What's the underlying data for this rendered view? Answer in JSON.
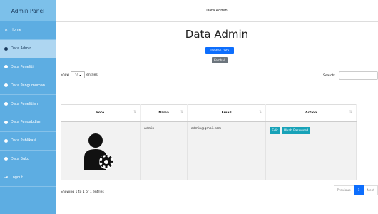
{
  "sidebar": {
    "brand": "Admin Panel",
    "items": [
      {
        "label": "Home",
        "icon": "home-icon"
      },
      {
        "label": "Data Admin",
        "icon": "circle-icon",
        "active": true
      },
      {
        "label": "Data Peneliti",
        "icon": "circle-icon"
      },
      {
        "label": "Data Pengumuman",
        "icon": "circle-icon"
      },
      {
        "label": "Data Penelitian",
        "icon": "circle-icon"
      },
      {
        "label": "Data Pengabdian",
        "icon": "circle-icon"
      },
      {
        "label": "Data Publikasi",
        "icon": "circle-icon"
      },
      {
        "label": "Data Buku",
        "icon": "circle-icon"
      },
      {
        "label": "Logout",
        "icon": "logout-icon"
      }
    ]
  },
  "header": {
    "title": "Data Admin"
  },
  "main": {
    "title": "Data Admin",
    "add_button": "Tambah Data",
    "back_button": "Kembali",
    "show_label": "Show",
    "show_value": "10",
    "entries_label": "entries",
    "search_label": "Search:"
  },
  "table": {
    "columns": [
      "Foto",
      "Nama",
      "Email",
      "Action"
    ],
    "rows": [
      {
        "nama": "admin",
        "email": "admin@gmail.com",
        "edit": "Edit",
        "ubah": "Ubah Password"
      }
    ]
  },
  "footer": {
    "info": "Showing 1 to 1 of 1 entries",
    "previous": "Previous",
    "page": "1",
    "next": "Next"
  },
  "colors": {
    "sidebar": "#5dade2",
    "primary": "#0d6efd",
    "info": "#17a2b8",
    "secondary": "#6c757d"
  }
}
